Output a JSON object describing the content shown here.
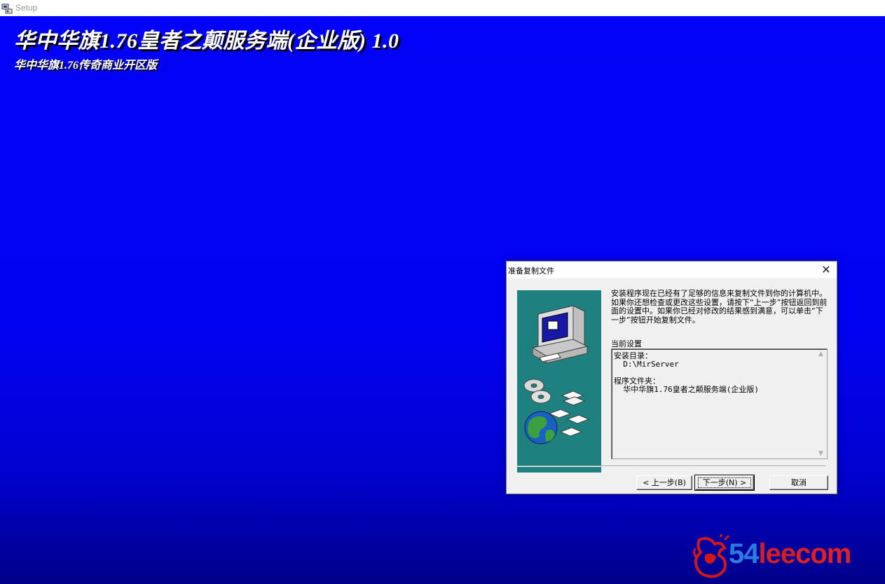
{
  "window": {
    "title": "Setup",
    "icon": "setup-app-icon"
  },
  "background": {
    "title": "华中华旗1.76皇者之颠服务端(企业版) 1.0",
    "subtitle": "华中华旗1.76传奇商业开区版",
    "color": "#0000ff"
  },
  "dialog": {
    "title": "准备复制文件",
    "close_glyph": "✕",
    "intro": "安装程序现在已经有了足够的信息来复制文件到你的计算机中。如果你还想检查或更改这些设置，请按下“上一步”按钮返回到前面的设置中。如果你已经对修改的结果感到满意，可以单击“下一步”按钮开始复制文件。",
    "settings_label": "当前设置",
    "settings_text": "安装目录：\n  D:\\MirServer\n\n程序文件夹：\n  华中华旗1.76皇者之颠服务端(企业版)",
    "scroll_up": "▲",
    "scroll_down": "▼",
    "buttons": {
      "back": "< 上一步(B)",
      "next": "下一步(N) >",
      "cancel": "取消"
    },
    "panel_color": "#1f8080"
  },
  "watermark": {
    "digits": "54",
    "lee": "lee",
    "com": "com"
  }
}
